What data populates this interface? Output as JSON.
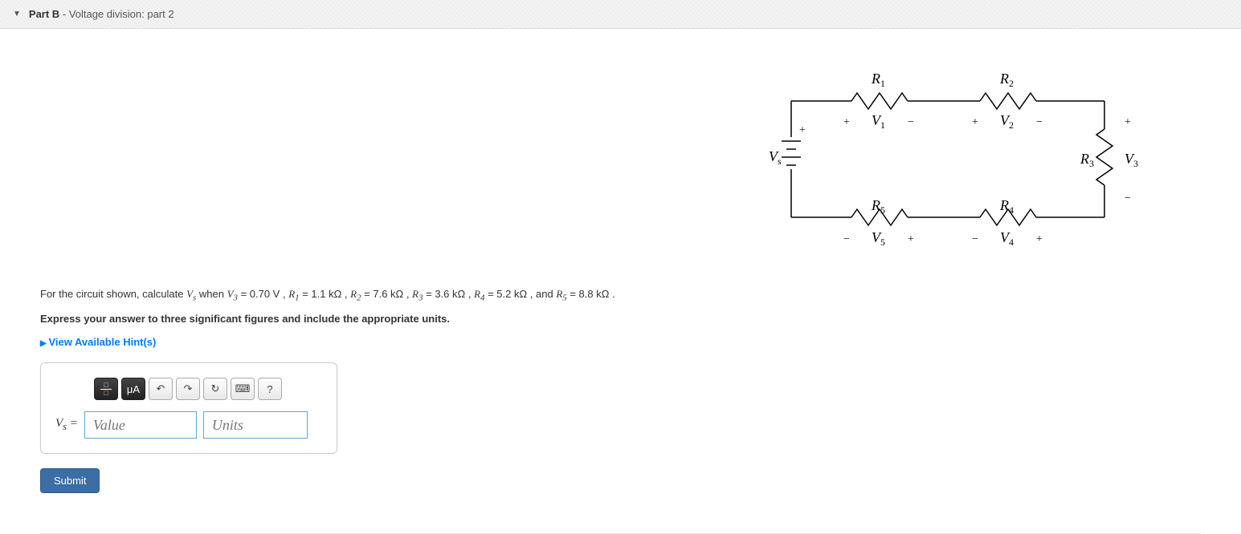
{
  "header": {
    "part_label": "Part B",
    "part_subtitle": "Voltage division: part 2"
  },
  "circuit": {
    "Vs": "V",
    "Vs_sub": "s",
    "R1": "R",
    "R1_sub": "1",
    "R2": "R",
    "R2_sub": "2",
    "R3": "R",
    "R3_sub": "3",
    "R4": "R",
    "R4_sub": "4",
    "R5": "R",
    "R5_sub": "5",
    "V1": "V",
    "V1_sub": "1",
    "V2": "V",
    "V2_sub": "2",
    "V3": "V",
    "V3_sub": "3",
    "V4": "V",
    "V4_sub": "4",
    "V5": "V",
    "V5_sub": "5",
    "plus": "+",
    "minus": "−"
  },
  "problem": {
    "intro": "For the circuit shown, calculate ",
    "vs_var": "V",
    "vs_sub": "s",
    "when": " when ",
    "v3_var": "V",
    "v3_sub": "3",
    "v3_val": " = 0.70 V",
    "sep": " , ",
    "r1_var": "R",
    "r1_sub": "1",
    "r1_val": " = 1.1 kΩ",
    "r2_var": "R",
    "r2_sub": "2",
    "r2_val": " = 7.6 kΩ",
    "r3_var": "R",
    "r3_sub": "3",
    "r3_val": " = 3.6 kΩ",
    "r4_var": "R",
    "r4_sub": "4",
    "r4_val": " = 5.2 kΩ",
    "and": " , and ",
    "r5_var": "R",
    "r5_sub": "5",
    "r5_val": " = 8.8 kΩ",
    "period": " .",
    "express": "Express your answer to three significant figures and include the appropriate units."
  },
  "hints": {
    "label": "View Available Hint(s)"
  },
  "toolbar": {
    "frac_top": "□",
    "frac_bot": "□",
    "ua": "μA",
    "undo": "↶",
    "redo": "↷",
    "reset": "↻",
    "keyboard": "⌨",
    "help": "?"
  },
  "answer": {
    "eq_label_var": "V",
    "eq_label_sub": "s",
    "eq_label_eq": " =",
    "value_ph": "Value",
    "units_ph": "Units"
  },
  "submit": {
    "label": "Submit"
  }
}
